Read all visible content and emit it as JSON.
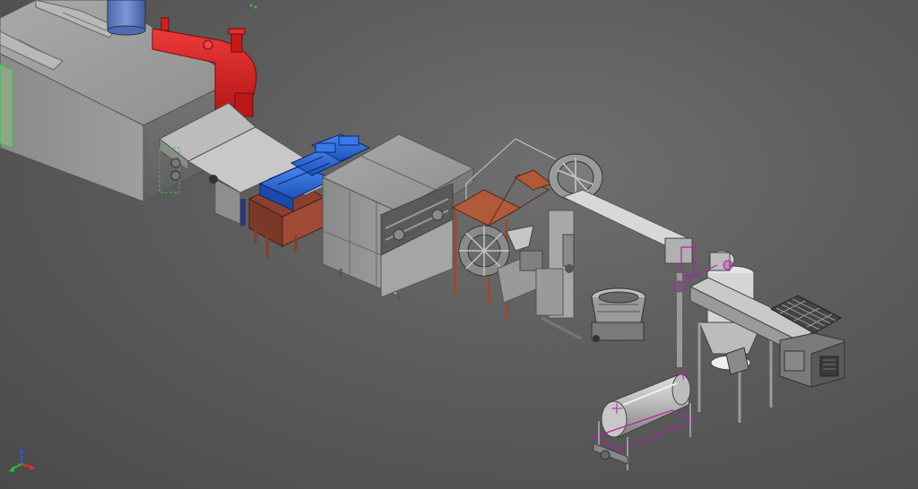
{
  "viewport": {
    "background_top": "#6f6f6f",
    "background_bottom": "#4a4a4a"
  },
  "colors": {
    "housing_gray": "#9a9a9a",
    "housing_dark": "#6e6e6e",
    "burner_red": "#d42020",
    "motor_blue": "#2a68d8",
    "tank_blue": "#5c7bc0",
    "frame_rust": "#9a4a2e",
    "accent_magenta": "#b020b0",
    "accent_green": "#3fbf3f"
  },
  "equipment": [
    {
      "id": "oven-tunnel",
      "icon": "tunnel-oven-icon"
    },
    {
      "id": "burner",
      "icon": "burner-icon"
    },
    {
      "id": "exhaust-stack",
      "icon": "exhaust-duct-icon"
    },
    {
      "id": "discharge-conveyor",
      "icon": "belt-conveyor-icon"
    },
    {
      "id": "sheeter",
      "icon": "sheeter-icon"
    },
    {
      "id": "drive-motors",
      "icon": "motor-icon"
    },
    {
      "id": "cutting-station",
      "icon": "cutter-icon"
    },
    {
      "id": "rotary-moulder",
      "icon": "rotary-moulder-icon"
    },
    {
      "id": "incline-conveyor",
      "icon": "incline-conveyor-icon"
    },
    {
      "id": "mixing-bowl",
      "icon": "mixing-bowl-icon"
    },
    {
      "id": "feed-hopper",
      "icon": "hopper-icon"
    },
    {
      "id": "screw-conveyor",
      "icon": "screw-conveyor-icon"
    },
    {
      "id": "sifter",
      "icon": "sifter-icon"
    },
    {
      "id": "rotary-drum",
      "icon": "rotary-drum-icon"
    }
  ],
  "triad": {
    "x_color": "#e03030",
    "y_color": "#30c030",
    "z_color": "#3050e0"
  }
}
